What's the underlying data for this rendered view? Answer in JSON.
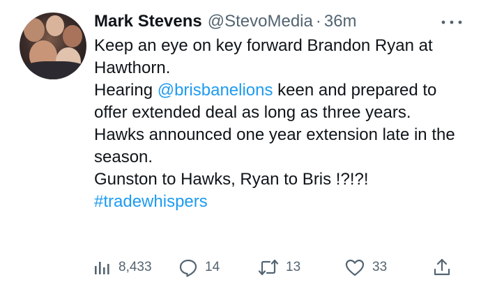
{
  "tweet": {
    "author": {
      "name": "Mark Stevens",
      "handle": "@StevoMedia",
      "separator": "·",
      "time": "36m"
    },
    "lines": {
      "l1": "Keep an eye on key forward Brandon Ryan at Hawthorn.",
      "l2_pre": "Hearing ",
      "l2_mention": "@brisbanelions",
      "l2_post": " keen and prepared to offer extended deal as long as three years.",
      "l3": "Hawks announced one year extension late in the season.",
      "l4": "Gunston to Hawks, Ryan to Bris !?!?!",
      "hashtag": "#tradewhispers"
    },
    "actions": {
      "views": {
        "icon": "views-chart-icon",
        "count": "8,433"
      },
      "replies": {
        "icon": "reply-bubble-icon",
        "count": "14"
      },
      "retweets": {
        "icon": "retweet-icon",
        "count": "13"
      },
      "likes": {
        "icon": "heart-icon",
        "count": "33"
      },
      "share": {
        "icon": "share-upload-icon"
      }
    },
    "colors": {
      "text": "#0f1419",
      "secondary": "#536471",
      "link": "#1d9bf0"
    }
  }
}
